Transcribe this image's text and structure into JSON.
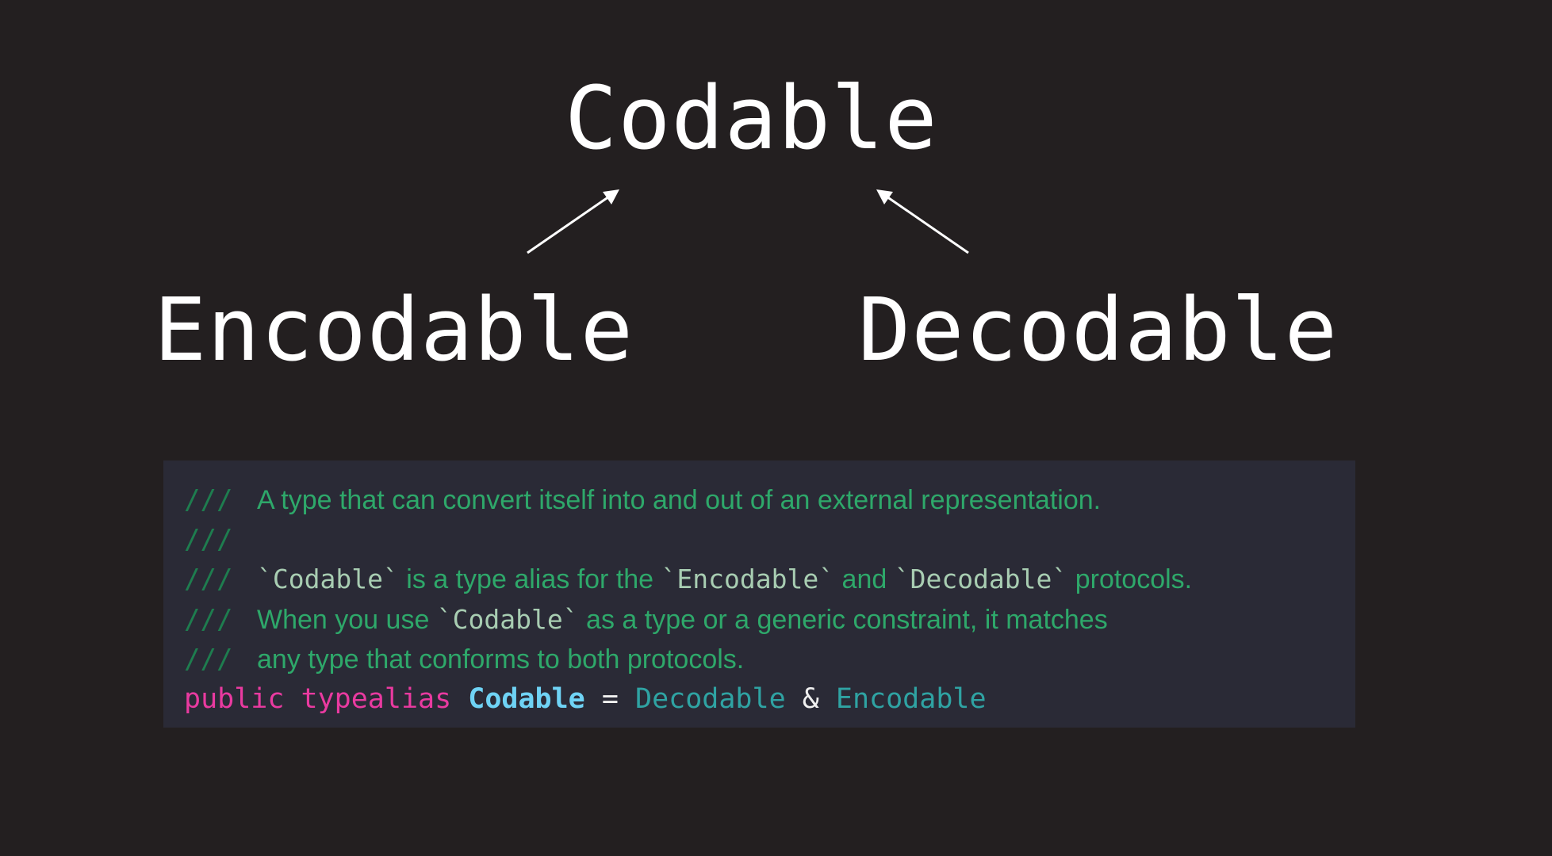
{
  "diagram": {
    "top_node": "Codable",
    "left_node": "Encodable",
    "right_node": "Decodable",
    "text_color": "#ffffff",
    "background": "#231f20"
  },
  "code": {
    "comment_prefix": "///",
    "doc_lines": [
      {
        "text": "A type that can convert itself into and out of an external representation."
      },
      {
        "text": ""
      },
      {
        "segments": [
          {
            "text": "`Codable`",
            "mono": true
          },
          {
            "text": " is a type alias for the ",
            "mono": false
          },
          {
            "text": "`Encodable`",
            "mono": true
          },
          {
            "text": " and ",
            "mono": false
          },
          {
            "text": "`Decodable`",
            "mono": true
          },
          {
            "text": " protocols.",
            "mono": false
          }
        ]
      },
      {
        "segments": [
          {
            "text": "When you use ",
            "mono": false
          },
          {
            "text": "`Codable`",
            "mono": true
          },
          {
            "text": " as a type or a generic constraint, it matches",
            "mono": false
          }
        ]
      },
      {
        "text": "any type that conforms to both protocols."
      }
    ],
    "declaration": {
      "keyword_public": "public",
      "keyword_typealias": "typealias",
      "type_name": "Codable",
      "equals": "=",
      "protocol_a": "Decodable",
      "amp": "&",
      "protocol_b": "Encodable"
    },
    "colors": {
      "panel_bg": "#2a2a36",
      "comment": "#2ea86a",
      "keyword": "#e93aa0",
      "type_name": "#6fd3f5",
      "protocol": "#2fa3a3"
    }
  }
}
